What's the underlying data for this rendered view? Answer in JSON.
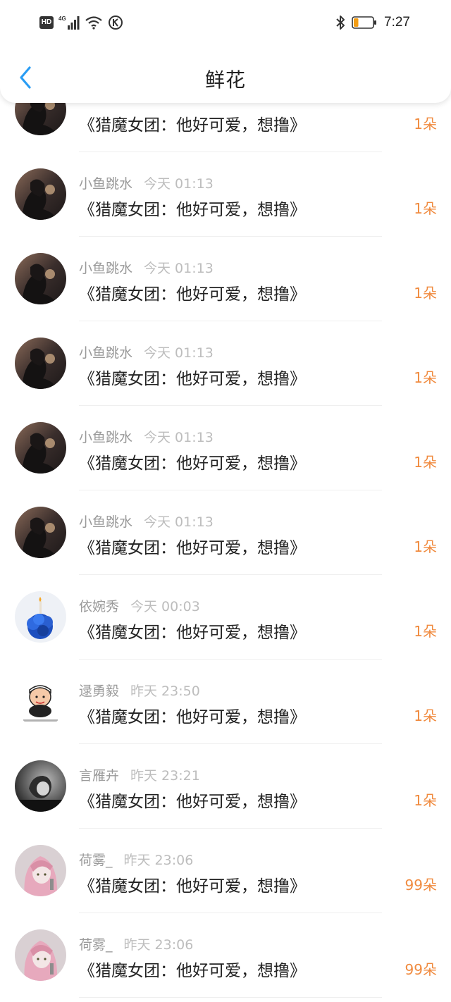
{
  "status_bar": {
    "network_badge": "HD",
    "network_type": "4G",
    "time": "7:27",
    "icons": [
      "hd-icon",
      "signal-icon",
      "wifi-icon",
      "k-icon",
      "bluetooth-icon",
      "battery-icon"
    ],
    "battery_level": 0.25,
    "battery_color": "#f39c12"
  },
  "header": {
    "title": "鲜花",
    "back_icon": "chevron-left-icon",
    "accent_color": "#2a9df4"
  },
  "items": [
    {
      "name": "",
      "time": "",
      "message": "《猎魔女团：他好可爱，想撸》",
      "count": "1朵",
      "avatar": "dark-portrait"
    },
    {
      "name": "小鱼跳水",
      "time": "今天 01:13",
      "message": "《猎魔女团：他好可爱，想撸》",
      "count": "1朵",
      "avatar": "dark-portrait"
    },
    {
      "name": "小鱼跳水",
      "time": "今天 01:13",
      "message": "《猎魔女团：他好可爱，想撸》",
      "count": "1朵",
      "avatar": "dark-portrait"
    },
    {
      "name": "小鱼跳水",
      "time": "今天 01:13",
      "message": "《猎魔女团：他好可爱，想撸》",
      "count": "1朵",
      "avatar": "dark-portrait"
    },
    {
      "name": "小鱼跳水",
      "time": "今天 01:13",
      "message": "《猎魔女团：他好可爱，想撸》",
      "count": "1朵",
      "avatar": "dark-portrait"
    },
    {
      "name": "小鱼跳水",
      "time": "今天 01:13",
      "message": "《猎魔女团：他好可爱，想撸》",
      "count": "1朵",
      "avatar": "dark-portrait"
    },
    {
      "name": "依婉秀",
      "time": "今天 00:03",
      "message": "《猎魔女团：他好可爱，想撸》",
      "count": "1朵",
      "avatar": "blue-flowers"
    },
    {
      "name": "逯勇毅",
      "time": "昨天 23:50",
      "message": "《猎魔女团：他好可爱，想撸》",
      "count": "1朵",
      "avatar": "cartoon-character"
    },
    {
      "name": "言雁卉",
      "time": "昨天 23:21",
      "message": "《猎魔女团：他好可爱，想撸》",
      "count": "1朵",
      "avatar": "child-photo"
    },
    {
      "name": "荷雾_",
      "time": "昨天 23:06",
      "message": "《猎魔女团：他好可爱，想撸》",
      "count": "99朵",
      "avatar": "anime-girl"
    },
    {
      "name": "荷雾_",
      "time": "昨天 23:06",
      "message": "《猎魔女团：他好可爱，想撸》",
      "count": "99朵",
      "avatar": "anime-girl"
    }
  ],
  "count_color": "#f08a3e"
}
